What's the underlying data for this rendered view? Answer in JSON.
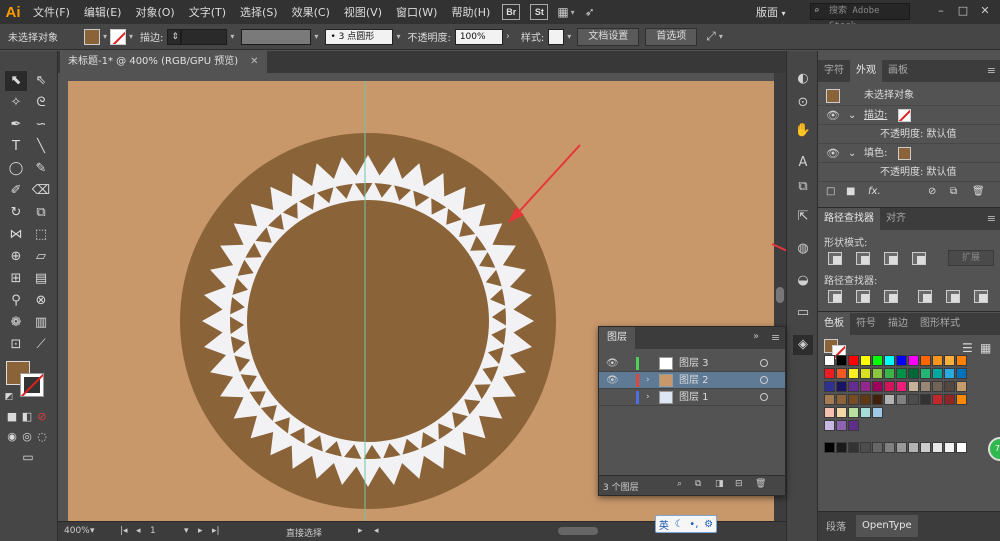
{
  "app": {
    "logo": "Ai"
  },
  "menu": {
    "items": [
      "文件(F)",
      "编辑(E)",
      "对象(O)",
      "文字(T)",
      "选择(S)",
      "效果(C)",
      "视图(V)",
      "窗口(W)",
      "帮助(H)"
    ],
    "bridge": "Br",
    "stock": "St",
    "workspace": "版面",
    "stock_search_placeholder": "搜索 Adobe Stock"
  },
  "control_bar": {
    "selection": "未选择对象",
    "stroke_label": "描边:",
    "brush": "3 点圆形",
    "opacity_label": "不透明度:",
    "opacity_value": "100%",
    "style_label": "样式:",
    "doc_settings": "文档设置",
    "preferences": "首选项"
  },
  "document": {
    "tab_title": "未标题-1* @ 400% (RGB/GPU 预览)",
    "zoom": "400%",
    "artboard_num": "1",
    "tool_status": "直接选择",
    "colors": {
      "artboard": "#c8976a",
      "disc": "#8b6338",
      "ring": "#f2f2f4",
      "guide": "#6fc6a8",
      "arrow": "#e8353a"
    }
  },
  "appearance_panel": {
    "tabs": [
      "字符",
      "外观",
      "画板"
    ],
    "active_tab": "外观",
    "title": "未选择对象",
    "stroke_label": "描边:",
    "opacity_1": "不透明度: 默认值",
    "fill_label": "填色:",
    "opacity_2": "不透明度: 默认值"
  },
  "pathfinder_panel": {
    "tabs": [
      "路径查找器",
      "对齐"
    ],
    "shape_modes_label": "形状模式:",
    "expand_button": "扩展",
    "pathfinders_label": "路径查找器:"
  },
  "swatches_panel": {
    "tabs": [
      "色板",
      "符号",
      "描边",
      "图形样式"
    ],
    "rows": [
      [
        "#ffffff",
        "#000000",
        "#ff0000",
        "#ffff00",
        "#00ff00",
        "#00ffff",
        "#0000ff",
        "#ff00ff",
        "#ff6600",
        "#f7941d",
        "#fbb03b",
        "#ff7f00"
      ],
      [
        "#ed1c24",
        "#f15a24",
        "#fcee21",
        "#d9e021",
        "#8cc63f",
        "#39b54a",
        "#009245",
        "#006837",
        "#22b573",
        "#00a99d",
        "#29abe2",
        "#0071bc"
      ],
      [
        "#2e3192",
        "#1b1464",
        "#662d91",
        "#93278f",
        "#9e005d",
        "#d4145a",
        "#ed1e79",
        "#c7b299",
        "#998675",
        "#736357",
        "#534741",
        "#c69c6d"
      ],
      [
        "#a67c52",
        "#8c6239",
        "#754c24",
        "#603813",
        "#42210b",
        "#b3b3b3",
        "#808080",
        "#4d4d4d",
        "#333333",
        "#c1272d",
        "#8f2525",
        "#ff8800"
      ],
      [
        "#f6bfb0",
        "#f3d7a6",
        "#b9dfa0",
        "#a6ddd9",
        "#9fc7e6"
      ],
      [
        "#c9b7e3",
        "#8e63b1",
        "#5d2f86"
      ],
      [
        "#000000",
        "#1a1a1a",
        "#333333",
        "#4d4d4d",
        "#666666",
        "#808080",
        "#999999",
        "#b3b3b3",
        "#cccccc",
        "#e6e6e6",
        "#f2f2f2",
        "#ffffff"
      ]
    ]
  },
  "layers_panel": {
    "title": "图层",
    "layers": [
      {
        "name": "图层 3",
        "color": "#4fd05a",
        "selected": false,
        "visible": true
      },
      {
        "name": "图层 2",
        "color": "#e0453d",
        "selected": true,
        "visible": true
      },
      {
        "name": "图层 1",
        "color": "#4f6fe0",
        "selected": false,
        "visible": false
      }
    ],
    "count": "3 个图层"
  },
  "bottom_tabs": [
    "段落",
    "OpenType"
  ],
  "ime": {
    "lang": "英"
  }
}
